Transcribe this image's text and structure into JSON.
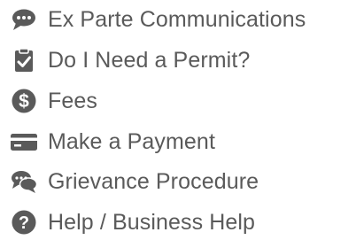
{
  "menu": {
    "icon_color": "#5a5a5a",
    "text_color": "#5a5a5a",
    "items": [
      {
        "label": "Ex Parte Communications",
        "icon": "speech-bubble-icon"
      },
      {
        "label": "Do I Need a Permit?",
        "icon": "clipboard-check-icon"
      },
      {
        "label": "Fees",
        "icon": "dollar-circle-icon"
      },
      {
        "label": "Make a Payment",
        "icon": "credit-card-icon"
      },
      {
        "label": "Grievance Procedure",
        "icon": "conversation-bubbles-icon"
      },
      {
        "label": "Help / Business Help",
        "icon": "question-circle-icon"
      }
    ]
  }
}
